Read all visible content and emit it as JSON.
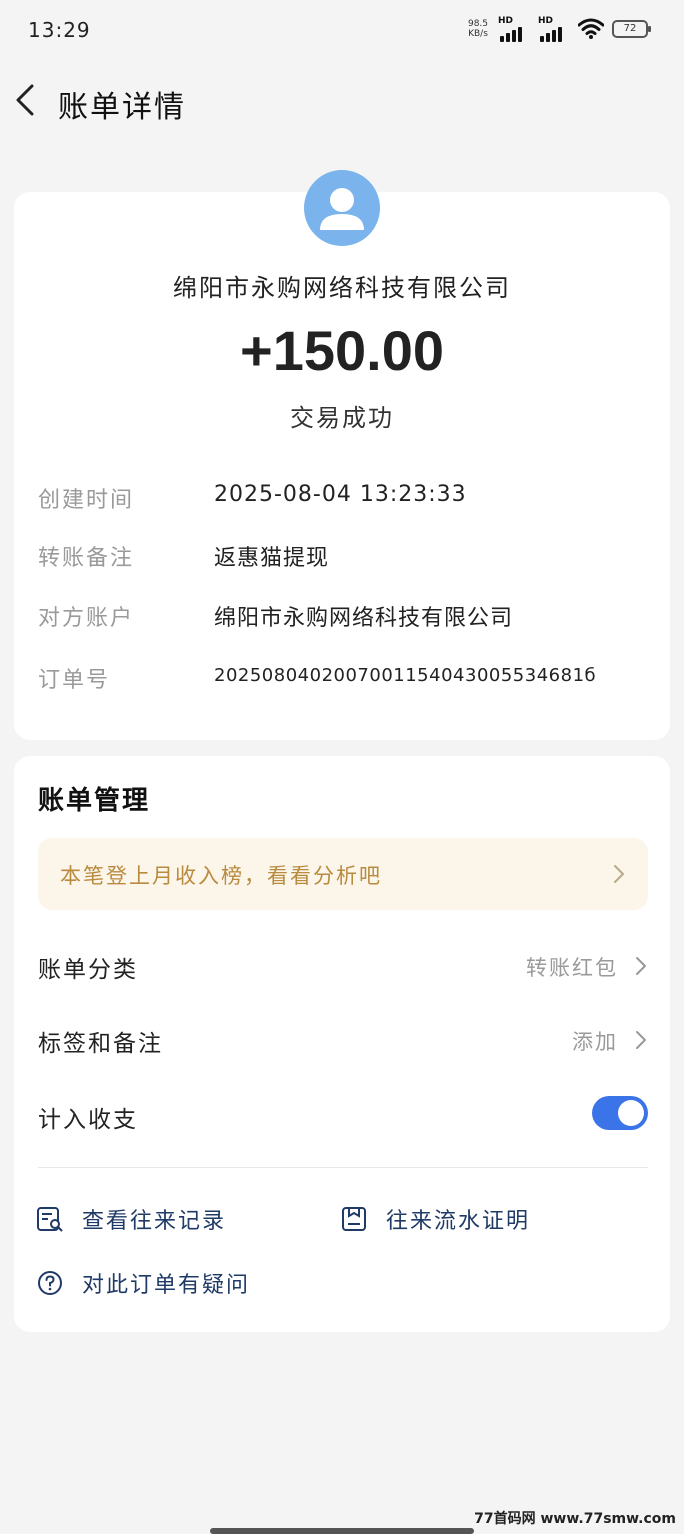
{
  "status_bar": {
    "time": "13:29",
    "net_speed_value": "98.5",
    "net_speed_unit": "KB/s",
    "sim1_label": "HD",
    "sim2_label": "HD",
    "battery": "72"
  },
  "nav": {
    "back_icon": "chevron-left-icon",
    "title": "账单详情"
  },
  "transaction": {
    "avatar_icon": "user-avatar-icon",
    "merchant": "绵阳市永购网络科技有限公司",
    "amount": "+150.00",
    "status": "交易成功",
    "details": [
      {
        "label": "创建时间",
        "value": "2025-08-04 13:23:33"
      },
      {
        "label": "转账备注",
        "value": "返惠猫提现"
      },
      {
        "label": "对方账户",
        "value": "绵阳市永购网络科技有限公司"
      },
      {
        "label": "订单号",
        "value": "2025080402007001154043005534681б"
      }
    ]
  },
  "management": {
    "title": "账单管理",
    "banner": "本笔登上月收入榜，看看分析吧",
    "rows": [
      {
        "label": "账单分类",
        "value": "转账红包"
      },
      {
        "label": "标签和备注",
        "value": "添加"
      },
      {
        "label": "计入收支",
        "toggle": true
      }
    ],
    "links": [
      {
        "icon": "record-search-icon",
        "label": "查看往来记录"
      },
      {
        "icon": "statement-icon",
        "label": "往来流水证明"
      },
      {
        "icon": "question-circle-icon",
        "label": "对此订单有疑问"
      }
    ]
  },
  "watermark": "77首码网 www.77smw.com",
  "colors": {
    "accent": "#3b74e8",
    "banner_bg": "#fbf5ea",
    "banner_text": "#b98b3e",
    "avatar": "#7bb4ec",
    "link_text": "#1f3a66"
  }
}
